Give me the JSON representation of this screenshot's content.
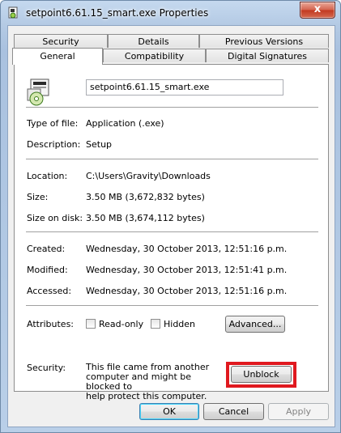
{
  "window": {
    "title": "setpoint6.61.15_smart.exe Properties",
    "close_glyph": "x"
  },
  "tabs": {
    "security": "Security",
    "details": "Details",
    "previous_versions": "Previous Versions",
    "general": "General",
    "compatibility": "Compatibility",
    "digital_signatures": "Digital Signatures"
  },
  "general": {
    "filename": "setpoint6.61.15_smart.exe",
    "type_label": "Type of file:",
    "type_value": "Application (.exe)",
    "description_label": "Description:",
    "description_value": "Setup",
    "location_label": "Location:",
    "location_value": "C:\\Users\\Gravity\\Downloads",
    "size_label": "Size:",
    "size_value": "3.50 MB (3,672,832 bytes)",
    "size_on_disk_label": "Size on disk:",
    "size_on_disk_value": "3.50 MB (3,674,112 bytes)",
    "created_label": "Created:",
    "created_value": "Wednesday, 30 October 2013, 12:51:16 p.m.",
    "modified_label": "Modified:",
    "modified_value": "Wednesday, 30 October 2013, 12:51:41 p.m.",
    "accessed_label": "Accessed:",
    "accessed_value": "Wednesday, 30 October 2013, 12:51:16 p.m.",
    "attributes_label": "Attributes:",
    "readonly_label": "Read-only",
    "hidden_label": "Hidden",
    "advanced_button": "Advanced...",
    "security_label": "Security:",
    "security_line1": "This file came from another",
    "security_line2": "computer and might be blocked to",
    "security_line3": "help protect this computer.",
    "unblock_button": "Unblock"
  },
  "footer": {
    "ok": "OK",
    "cancel": "Cancel",
    "apply": "Apply"
  },
  "colors": {
    "highlight": "#e0191f",
    "title_bar": "#b4cae4"
  }
}
